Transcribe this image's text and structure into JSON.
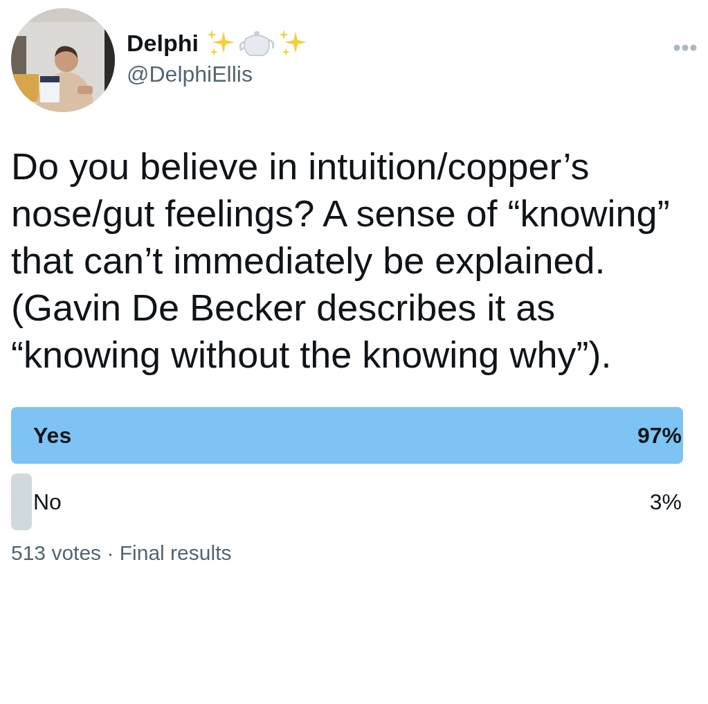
{
  "author": {
    "name": "Delphi",
    "handle": "@DelphiEllis"
  },
  "text": "Do you believe in intuition/copper’s nose/gut feelings? A sense of “knowing” that can’t immediately be explained. (Gavin De Becker describes it as “knowing without the knowing why”).",
  "poll": {
    "options": [
      {
        "label": "Yes",
        "percent": "97%",
        "level": 0.97,
        "winner": true
      },
      {
        "label": "No",
        "percent": "3%",
        "level": 0.03,
        "winner": false
      }
    ],
    "summary": "513 votes · Final results"
  }
}
